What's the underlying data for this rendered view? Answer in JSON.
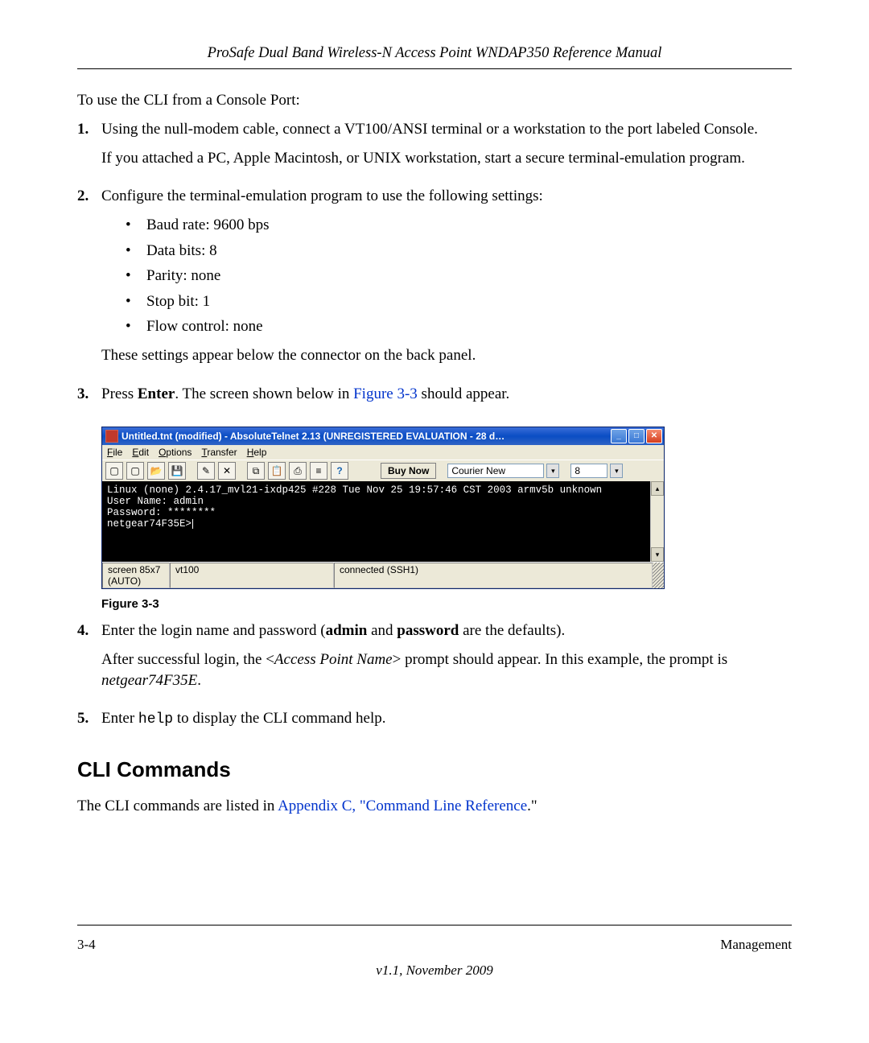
{
  "header": {
    "title": "ProSafe Dual Band Wireless-N Access Point WNDAP350 Reference Manual"
  },
  "intro": "To use the CLI from a Console Port:",
  "steps": {
    "s1": {
      "num": "1.",
      "p1": "Using the null-modem cable, connect a VT100/ANSI terminal or a workstation to the port labeled Console.",
      "p2": "If you attached a PC, Apple Macintosh, or UNIX workstation, start a secure terminal-emulation program."
    },
    "s2": {
      "num": "2.",
      "lead": "Configure the terminal-emulation program to use the following settings:",
      "b1": "Baud rate: 9600 bps",
      "b2": "Data bits: 8",
      "b3": "Parity: none",
      "b4": "Stop bit: 1",
      "b5": "Flow control: none",
      "tail": "These settings appear below the connector on the back panel."
    },
    "s3": {
      "num": "3.",
      "t1": "Press ",
      "enter": "Enter",
      "t2": ". The screen shown below in ",
      "figref": "Figure 3-3",
      "t3": " should appear."
    },
    "s4": {
      "num": "4.",
      "t1": "Enter the login name and password (",
      "admin": "admin",
      "and": " and ",
      "password": "password",
      "t2": " are the defaults).",
      "p2a": "After successful login, the <",
      "p2i": "Access Point Name",
      "p2b": "> prompt should appear. In this example, the prompt is ",
      "p2c": "netgear74F35E",
      "p2d": "."
    },
    "s5": {
      "num": "5.",
      "t1": "Enter ",
      "help": "help",
      "t2": " to display the CLI command help."
    }
  },
  "figure": {
    "titlebar": "Untitled.tnt (modified) - AbsoluteTelnet 2.13   (UNREGISTERED EVALUATION - 28 d…",
    "menu": {
      "file": "File",
      "edit": "Edit",
      "options": "Options",
      "transfer": "Transfer",
      "help": "Help"
    },
    "buynow": "Buy Now",
    "font": "Courier New",
    "fontsize": "8",
    "terminal_line1": "Linux (none) 2.4.17_mvl21-ixdp425 #228 Tue Nov 25 19:57:46 CST 2003 armv5b unknown",
    "terminal_line2": "User Name: admin",
    "terminal_line3": "Password: ********",
    "terminal_line4": "netgear74F35E>",
    "status1": "screen 85x7 (AUTO)",
    "status2": "vt100",
    "status3": "connected (SSH1)",
    "caption": "Figure 3-3"
  },
  "section_heading": "CLI Commands",
  "after": {
    "t1": "The CLI commands are listed in ",
    "link": "Appendix C, \"Command Line Reference",
    "t2": ".\""
  },
  "footer": {
    "left": "3-4",
    "right": "Management",
    "version": "v1.1, November 2009"
  }
}
